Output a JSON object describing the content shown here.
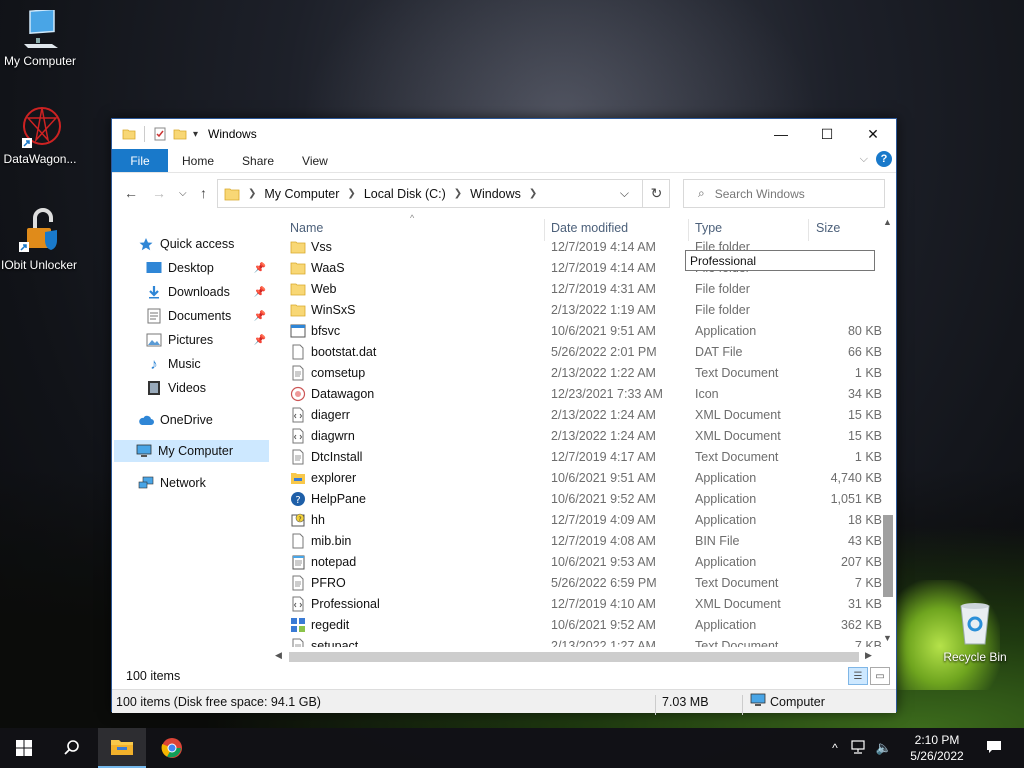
{
  "desktop": {
    "icons": [
      {
        "label": "My Computer"
      },
      {
        "label": "DataWagon..."
      },
      {
        "label": "IObit Unlocker"
      },
      {
        "label": "Recycle Bin"
      }
    ]
  },
  "window": {
    "title": "Windows",
    "controls": {
      "minimize": "—",
      "maximize": "☐",
      "close": "✕"
    },
    "ribbon_tabs": [
      "File",
      "Home",
      "Share",
      "View"
    ],
    "address": {
      "crumbs": [
        "My Computer",
        "Local Disk (C:)",
        "Windows"
      ],
      "search_placeholder": "Search Windows"
    },
    "nav": [
      {
        "label": "Quick access",
        "icon": "star-icon"
      },
      {
        "label": "Desktop",
        "icon": "desktop-icon",
        "pinned": true
      },
      {
        "label": "Downloads",
        "icon": "download-icon",
        "pinned": true
      },
      {
        "label": "Documents",
        "icon": "documents-icon",
        "pinned": true
      },
      {
        "label": "Pictures",
        "icon": "pictures-icon",
        "pinned": true
      },
      {
        "label": "Music",
        "icon": "music-icon"
      },
      {
        "label": "Videos",
        "icon": "videos-icon"
      },
      {
        "label": "OneDrive",
        "icon": "cloud-icon"
      },
      {
        "label": "My Computer",
        "icon": "computer-icon",
        "selected": true
      },
      {
        "label": "Network",
        "icon": "network-icon"
      }
    ],
    "columns": {
      "name": "Name",
      "date": "Date modified",
      "type": "Type",
      "size": "Size"
    },
    "files": [
      {
        "name": "Vss",
        "date": "12/7/2019 4:14 AM",
        "type": "File folder",
        "size": "",
        "icon": "folder-icon"
      },
      {
        "name": "WaaS",
        "date": "12/7/2019 4:14 AM",
        "type": "File folder",
        "size": "",
        "icon": "folder-icon"
      },
      {
        "name": "Web",
        "date": "12/7/2019 4:31 AM",
        "type": "File folder",
        "size": "",
        "icon": "folder-icon"
      },
      {
        "name": "WinSxS",
        "date": "2/13/2022 1:19 AM",
        "type": "File folder",
        "size": "",
        "icon": "folder-icon"
      },
      {
        "name": "bfsvc",
        "date": "10/6/2021 9:51 AM",
        "type": "Application",
        "size": "80 KB",
        "icon": "app-icon"
      },
      {
        "name": "bootstat.dat",
        "date": "5/26/2022 2:01 PM",
        "type": "DAT File",
        "size": "66 KB",
        "icon": "file-icon"
      },
      {
        "name": "comsetup",
        "date": "2/13/2022 1:22 AM",
        "type": "Text Document",
        "size": "1 KB",
        "icon": "text-file-icon"
      },
      {
        "name": "Datawagon",
        "date": "12/23/2021 7:33 AM",
        "type": "Icon",
        "size": "34 KB",
        "icon": "datawagon-icon"
      },
      {
        "name": "diagerr",
        "date": "2/13/2022 1:24 AM",
        "type": "XML Document",
        "size": "15 KB",
        "icon": "xml-file-icon"
      },
      {
        "name": "diagwrn",
        "date": "2/13/2022 1:24 AM",
        "type": "XML Document",
        "size": "15 KB",
        "icon": "xml-file-icon"
      },
      {
        "name": "DtcInstall",
        "date": "12/7/2019 4:17 AM",
        "type": "Text Document",
        "size": "1 KB",
        "icon": "text-file-icon"
      },
      {
        "name": "explorer",
        "date": "10/6/2021 9:51 AM",
        "type": "Application",
        "size": "4,740 KB",
        "icon": "explorer-icon"
      },
      {
        "name": "HelpPane",
        "date": "10/6/2021 9:52 AM",
        "type": "Application",
        "size": "1,051 KB",
        "icon": "help-icon"
      },
      {
        "name": "hh",
        "date": "12/7/2019 4:09 AM",
        "type": "Application",
        "size": "18 KB",
        "icon": "hh-icon"
      },
      {
        "name": "mib.bin",
        "date": "12/7/2019 4:08 AM",
        "type": "BIN File",
        "size": "43 KB",
        "icon": "file-icon"
      },
      {
        "name": "notepad",
        "date": "10/6/2021 9:53 AM",
        "type": "Application",
        "size": "207 KB",
        "icon": "notepad-icon"
      },
      {
        "name": "PFRO",
        "date": "5/26/2022 6:59 PM",
        "type": "Text Document",
        "size": "7 KB",
        "icon": "text-file-icon"
      },
      {
        "name": "Professional",
        "date": "12/7/2019 4:10 AM",
        "type": "XML Document",
        "size": "31 KB",
        "icon": "xml-file-icon"
      },
      {
        "name": "regedit",
        "date": "10/6/2021 9:52 AM",
        "type": "Application",
        "size": "362 KB",
        "icon": "regedit-icon"
      },
      {
        "name": "setupact",
        "date": "2/13/2022 1:27 AM",
        "type": "Text Document",
        "size": "7 KB",
        "icon": "text-file-icon"
      }
    ],
    "tooltip": "Professional",
    "item_count": "100 items",
    "status": {
      "left": "100 items (Disk free space: 94.1 GB)",
      "middle": "7.03 MB",
      "right": "Computer"
    }
  },
  "taskbar": {
    "time": "2:10 PM",
    "date": "5/26/2022"
  },
  "colors": {
    "accent": "#1979ca",
    "selection": "#cde8ff",
    "folder": "#f8d775"
  }
}
